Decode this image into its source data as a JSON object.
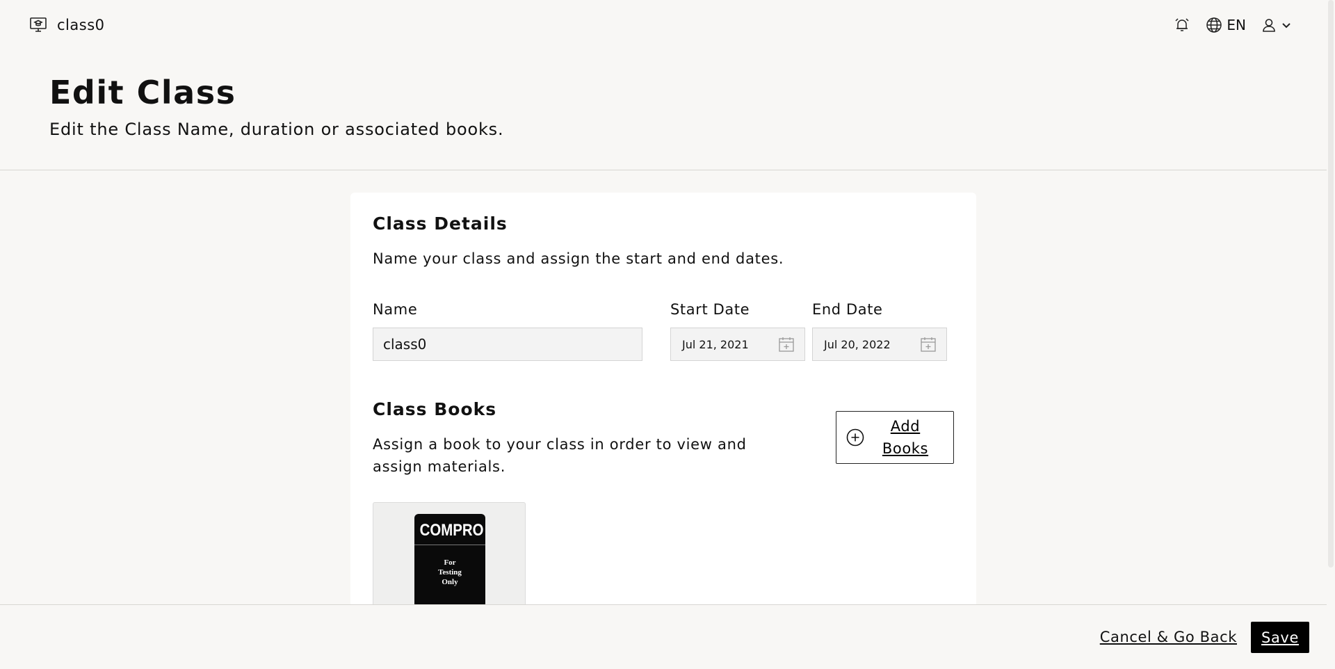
{
  "header": {
    "app_icon": "classroom-icon",
    "class_name": "class0",
    "notification_icon": "alarm-bell-icon",
    "language_icon": "globe-icon",
    "language": "EN",
    "user_icon": "user-icon",
    "dropdown_icon": "chevron-down-icon"
  },
  "page": {
    "title": "Edit Class",
    "subtitle": "Edit the Class Name, duration or associated books."
  },
  "class_details": {
    "title": "Class Details",
    "description": "Name your class and assign the start and end dates.",
    "name_label": "Name",
    "name_value": "class0",
    "start_date_label": "Start Date",
    "start_date_value": "Jul 21, 2021",
    "end_date_label": "End Date",
    "end_date_value": "Jul 20, 2022",
    "calendar_icon": "calendar-plus-icon"
  },
  "class_books": {
    "title": "Class Books",
    "description": "Assign a book to your class in order to view and assign materials.",
    "add_books_label": "Add Books",
    "add_icon": "plus-circle-icon",
    "books": [
      {
        "cover_title": "COMPRO",
        "cover_subtitle": "For\nTesting\nOnly"
      }
    ]
  },
  "footer": {
    "cancel_label": "Cancel & Go Back",
    "save_label": "Save"
  }
}
